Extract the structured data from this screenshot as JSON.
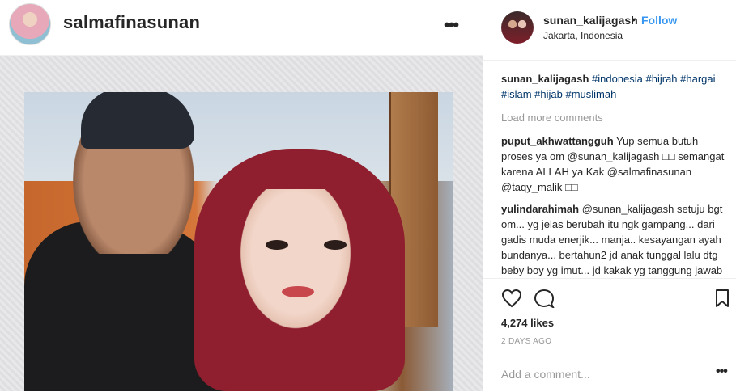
{
  "post": {
    "author": "salmafinasunan",
    "more_icon": "more-horizontal-icon",
    "more_glyph": "•••"
  },
  "sidebar": {
    "username": "sunan_kalijagash",
    "separator": "•",
    "follow_label": "Follow",
    "location": "Jakarta, Indonesia",
    "accent_color": "#3897f0"
  },
  "comments": {
    "caption_user": "sunan_kalijagash",
    "caption_tags": "#indonesia #hijrah #hargai #islam #hijab #muslimah",
    "load_more": "Load more comments",
    "items": [
      {
        "user": "puput_akhwattangguh",
        "text": "Yup semua butuh proses ya om @sunan_kalijagash □□ semangat karena ALLAH ya Kak @salmafinasunan @taqy_malik □□"
      },
      {
        "user": "yulindarahimah",
        "text": "@sunan_kalijagash setuju bgt om... yg jelas berubah itu ngk gampang... dari gadis muda enerjik... manja.. kesayangan ayah bundanya... bertahun2 jd anak tunggal lalu dtg beby boy yg imut... jd kakak yg tanggung jawab"
      }
    ]
  },
  "actions": {
    "like_icon": "heart-icon",
    "comment_icon": "comment-bubble-icon",
    "save_icon": "bookmark-icon",
    "likes": "4,274 likes",
    "date": "2 DAYS AGO"
  },
  "add_comment": {
    "placeholder": "Add a comment...",
    "more_glyph": "•••"
  }
}
